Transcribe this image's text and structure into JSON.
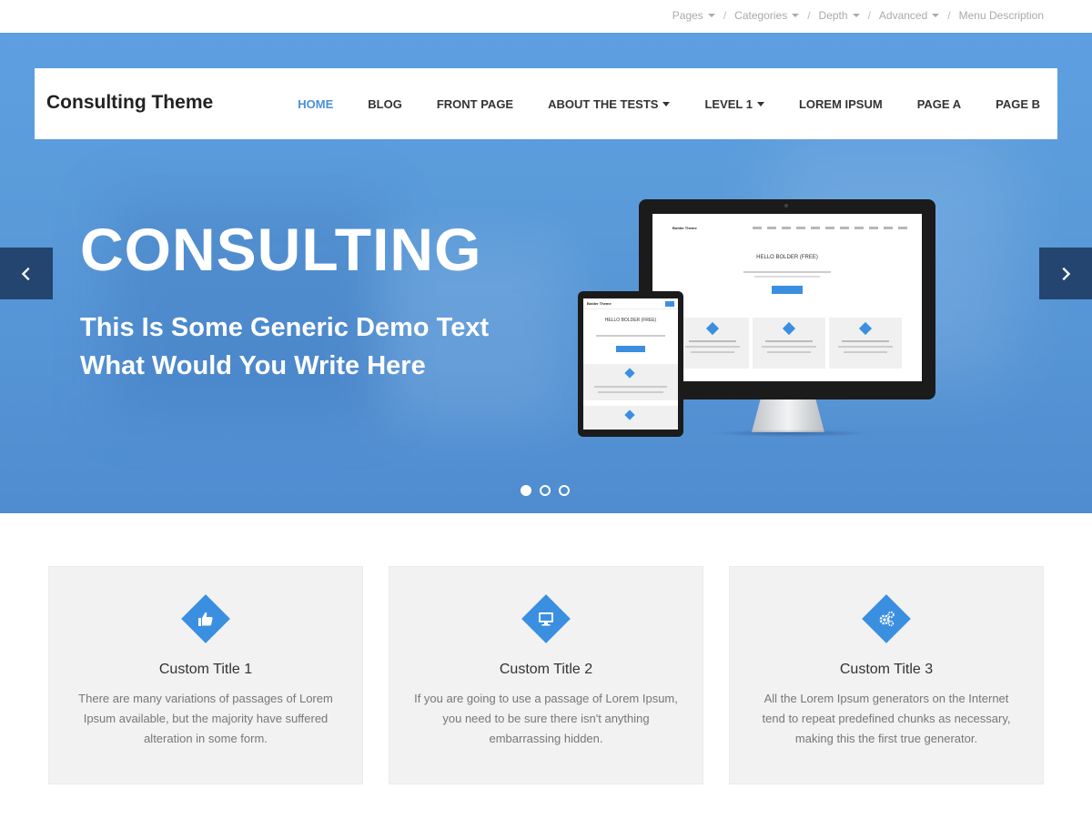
{
  "topbar": {
    "items": [
      {
        "label": "Pages",
        "has_caret": true
      },
      {
        "label": "Categories",
        "has_caret": true
      },
      {
        "label": "Depth",
        "has_caret": true
      },
      {
        "label": "Advanced",
        "has_caret": true
      },
      {
        "label": "Menu Description",
        "has_caret": false
      }
    ],
    "separator": "/"
  },
  "header": {
    "brand": "Consulting Theme",
    "nav": [
      {
        "label": "HOME",
        "active": true
      },
      {
        "label": "BLOG"
      },
      {
        "label": "FRONT PAGE"
      },
      {
        "label": "ABOUT THE TESTS",
        "has_caret": true
      },
      {
        "label": "LEVEL 1",
        "has_caret": true
      },
      {
        "label": "LOREM IPSUM"
      },
      {
        "label": "PAGE A"
      },
      {
        "label": "PAGE B"
      }
    ]
  },
  "hero": {
    "title": "CONSULTING",
    "subtitle_line1": "This Is Some Generic Demo Text",
    "subtitle_line2": "What Would You Write Here",
    "slides": 3,
    "active_slide": 1,
    "mockup": {
      "monitor_brand": "Bolder Theme",
      "monitor_heading": "HELLO BOLDER (FREE)",
      "tablet_brand": "Bolder Theme",
      "tablet_heading": "HELLO BOLDER (FREE)"
    }
  },
  "features": [
    {
      "icon": "thumbs-up-icon",
      "title": "Custom Title 1",
      "text": "There are many variations of passages of Lorem Ipsum available, but the majority have suffered alteration in some form."
    },
    {
      "icon": "monitor-icon",
      "title": "Custom Title 2",
      "text": "If you are going to use a passage of Lorem Ipsum, you need to be sure there isn't anything embarrassing hidden."
    },
    {
      "icon": "gears-icon",
      "title": "Custom Title 3",
      "text": "All the Lorem Ipsum generators on the Internet tend to repeat predefined chunks as necessary, making this the first true generator."
    }
  ],
  "colors": {
    "accent": "#3b8fe0",
    "active_nav": "#4a90d9",
    "arrow_bg": "#24456f",
    "feature_bg": "#f2f2f2"
  }
}
